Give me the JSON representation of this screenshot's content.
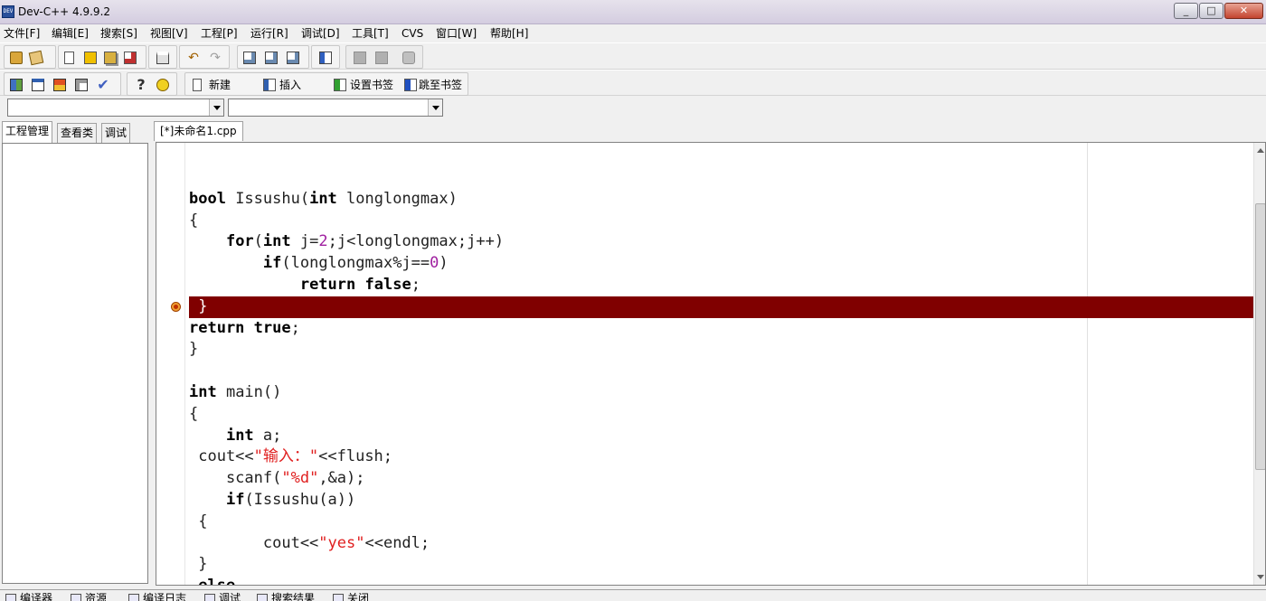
{
  "window": {
    "title": "Dev-C++ 4.9.9.2",
    "logo_text": "DEV"
  },
  "menu": [
    "文件[F]",
    "编辑[E]",
    "搜索[S]",
    "视图[V]",
    "工程[P]",
    "运行[R]",
    "调试[D]",
    "工具[T]",
    "CVS",
    "窗口[W]",
    "帮助[H]"
  ],
  "toolbar2": {
    "new_label": "新建",
    "insert_label": "插入",
    "set_bookmark_label": "设置书签",
    "goto_bookmark_label": "跳至书签"
  },
  "left_tabs": [
    "工程管理",
    "查看类",
    "调试"
  ],
  "editor": {
    "file_tab": "[*]未命名1.cpp",
    "breakpoint_line": 6
  },
  "code_lines": [
    [],
    [
      {
        "t": "bool",
        "c": "kw"
      },
      {
        "t": " Issushu("
      },
      {
        "t": "int",
        "c": "kw"
      },
      {
        "t": " longlongmax)"
      }
    ],
    [
      {
        "t": "{"
      }
    ],
    [
      {
        "t": "    "
      },
      {
        "t": "for",
        "c": "kw"
      },
      {
        "t": "("
      },
      {
        "t": "int",
        "c": "kw"
      },
      {
        "t": " j="
      },
      {
        "t": "2",
        "c": "num"
      },
      {
        "t": ";j<longlongmax;j++)"
      }
    ],
    [
      {
        "t": "        "
      },
      {
        "t": "if",
        "c": "kw"
      },
      {
        "t": "(longlongmax%j=="
      },
      {
        "t": "0",
        "c": "num"
      },
      {
        "t": ")"
      }
    ],
    [
      {
        "t": "            "
      },
      {
        "t": "return",
        "c": "kw"
      },
      {
        "t": " "
      },
      {
        "t": "false",
        "c": "kw"
      },
      {
        "t": ";"
      }
    ],
    [
      {
        "t": " }"
      }
    ],
    [
      {
        "t": "return",
        "c": "kw"
      },
      {
        "t": " "
      },
      {
        "t": "true",
        "c": "kw"
      },
      {
        "t": ";"
      }
    ],
    [
      {
        "t": "}"
      }
    ],
    [],
    [
      {
        "t": "int",
        "c": "kw"
      },
      {
        "t": " main()"
      }
    ],
    [
      {
        "t": "{"
      }
    ],
    [
      {
        "t": "    "
      },
      {
        "t": "int",
        "c": "kw"
      },
      {
        "t": " a;"
      }
    ],
    [
      {
        "t": " cout<<"
      },
      {
        "t": "\"输入：\"",
        "c": "str"
      },
      {
        "t": "<<flush;"
      }
    ],
    [
      {
        "t": "    scanf("
      },
      {
        "t": "\"%d\"",
        "c": "str"
      },
      {
        "t": ",&a);"
      }
    ],
    [
      {
        "t": "    "
      },
      {
        "t": "if",
        "c": "kw"
      },
      {
        "t": "(Issushu(a))"
      }
    ],
    [
      {
        "t": " {"
      }
    ],
    [
      {
        "t": "        cout<<"
      },
      {
        "t": "\"yes\"",
        "c": "str"
      },
      {
        "t": "<<endl;"
      }
    ],
    [
      {
        "t": " }"
      }
    ],
    [
      {
        "t": " "
      },
      {
        "t": "else",
        "c": "kw"
      }
    ],
    [
      {
        "t": " {"
      }
    ]
  ],
  "bottom_tabs": [
    "编译器",
    "资源",
    "编译日志",
    "调试",
    "搜索结果",
    "关闭"
  ]
}
